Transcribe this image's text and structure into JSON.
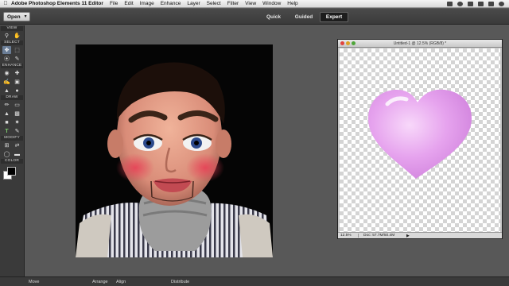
{
  "menubar": {
    "app_name": "Adobe Photoshop Elements 11 Editor",
    "items": [
      "File",
      "Edit",
      "Image",
      "Enhance",
      "Layer",
      "Select",
      "Filter",
      "View",
      "Window",
      "Help"
    ],
    "status_icons": [
      "bluetooth-icon",
      "time-machine-icon",
      "wifi-icon",
      "volume-icon",
      "battery-icon",
      "spotlight-icon"
    ]
  },
  "toolbar": {
    "open_label": "Open",
    "modes": [
      {
        "label": "Quick",
        "active": false
      },
      {
        "label": "Guided",
        "active": false
      },
      {
        "label": "Expert",
        "active": true
      }
    ]
  },
  "tools": {
    "sections": [
      "VIEW",
      "SELECT",
      "ENHANCE",
      "DRAW",
      "MODIFY",
      "COLOR"
    ],
    "colors": {
      "foreground": "#000000",
      "background": "#ffffff",
      "selected_tool": "#6a7d96"
    }
  },
  "document": {
    "title": "Untitled-1 @ 12.5% (RGB/8) *",
    "zoom": "12.5%",
    "doc_size": "Doc: 57.7M/50.4M",
    "heart_color": "#e6a3ee"
  },
  "bottom_bar": {
    "items": [
      "Move",
      "Arrange",
      "Align",
      "Distribute"
    ]
  }
}
